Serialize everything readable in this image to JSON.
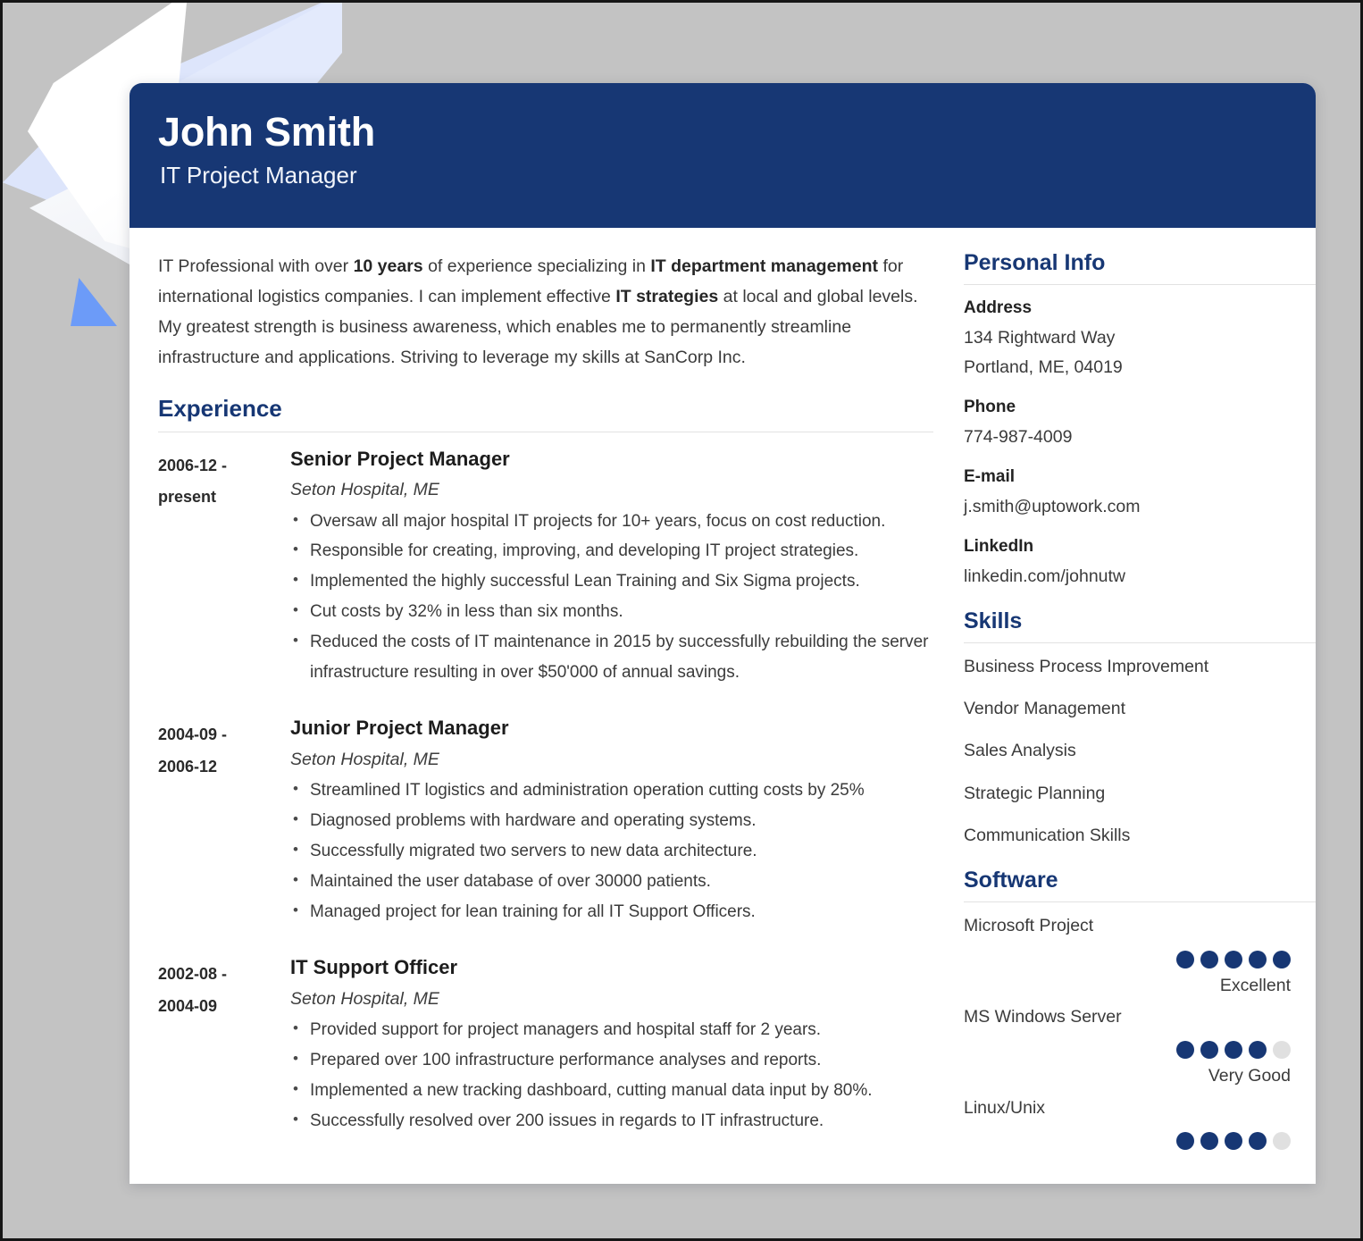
{
  "header": {
    "name": "John Smith",
    "job_title": "IT Project Manager",
    "accent_color": "#173774"
  },
  "summary": {
    "part1": "IT Professional with over ",
    "bold1": "10 years",
    "part2": " of experience specializing in ",
    "bold2": "IT department management",
    "part3": " for international logistics companies. I can implement effective ",
    "bold3": "IT strategies",
    "part4": " at local and global levels. My greatest strength is business awareness, which enables me to permanently streamline infrastructure and applications. Striving to leverage my skills at SanCorp Inc."
  },
  "experience": {
    "heading": "Experience",
    "jobs": [
      {
        "date_start": "2006-12 -",
        "date_end": "present",
        "title": "Senior Project Manager",
        "company": "Seton Hospital, ME",
        "bullets": [
          "Oversaw all major hospital IT projects for 10+ years, focus on cost reduction.",
          "Responsible for creating, improving, and developing IT project strategies.",
          "Implemented the highly successful Lean Training and Six Sigma projects.",
          "Cut costs by 32% in less than six months.",
          "Reduced the costs of IT maintenance in 2015 by successfully rebuilding the server infrastructure resulting in over $50'000 of annual savings."
        ]
      },
      {
        "date_start": "2004-09 -",
        "date_end": "2006-12",
        "title": "Junior Project Manager",
        "company": "Seton Hospital, ME",
        "bullets": [
          "Streamlined IT logistics and administration operation cutting costs by 25%",
          "Diagnosed problems with hardware and operating systems.",
          "Successfully migrated two servers to new data architecture.",
          "Maintained the user database of over 30000 patients.",
          "Managed project for lean training for all IT Support Officers."
        ]
      },
      {
        "date_start": "2002-08 -",
        "date_end": "2004-09",
        "title": "IT Support Officer",
        "company": "Seton Hospital, ME",
        "bullets": [
          "Provided support for project managers and hospital staff for 2 years.",
          "Prepared over 100 infrastructure performance analyses and reports.",
          "Implemented a new tracking dashboard, cutting manual data input by 80%.",
          "Successfully resolved over 200 issues in regards to IT infrastructure."
        ]
      }
    ]
  },
  "personal_info": {
    "heading": "Personal Info",
    "blocks": [
      {
        "label": "Address",
        "line1": "134 Rightward Way",
        "line2": "Portland, ME, 04019"
      },
      {
        "label": "Phone",
        "line1": "774-987-4009",
        "line2": ""
      },
      {
        "label": "E-mail",
        "line1": "j.smith@uptowork.com",
        "line2": ""
      },
      {
        "label": "LinkedIn",
        "line1": "linkedin.com/johnutw",
        "line2": ""
      }
    ]
  },
  "skills": {
    "heading": "Skills",
    "items": [
      "Business Process Improvement",
      "Vendor Management",
      "Sales Analysis",
      "Strategic Planning",
      "Communication Skills"
    ]
  },
  "software": {
    "heading": "Software",
    "max_dots": 5,
    "items": [
      {
        "name": "Microsoft Project",
        "rating": 5,
        "level": "Excellent"
      },
      {
        "name": "MS Windows Server",
        "rating": 4,
        "level": "Very Good"
      },
      {
        "name": "Linux/Unix",
        "rating": 4,
        "level": ""
      }
    ]
  }
}
